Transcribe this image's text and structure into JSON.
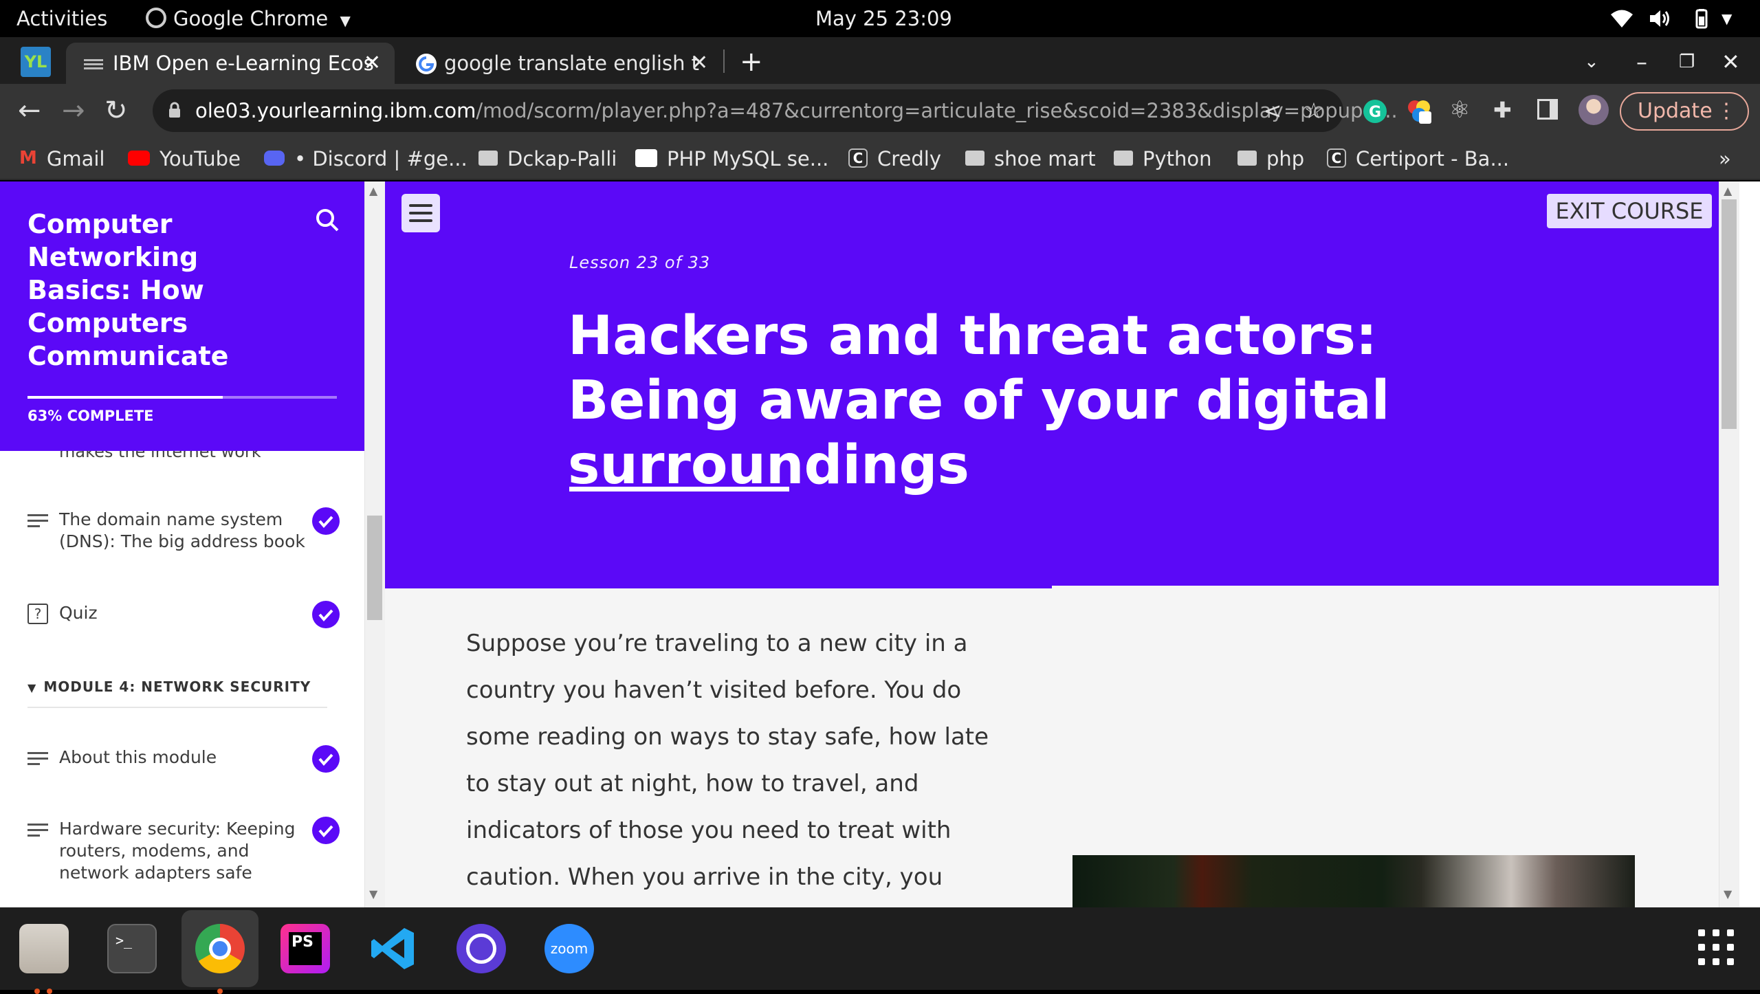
{
  "system": {
    "activities": "Activities",
    "app_name": "Google Chrome",
    "clock": "May 25  23:09"
  },
  "tabs": [
    {
      "title": "IBM Open e-Learning Ecos",
      "active": true
    },
    {
      "title": "google translate english t",
      "active": false
    }
  ],
  "toolbar": {
    "url_host": "ole03.yourlearning.ibm.com",
    "url_path": "/mod/scorm/player.php?a=487&currentorg=articulate_rise&scoid=2383&display=popup&...",
    "update_label": "Update"
  },
  "bookmarks": [
    {
      "label": "Gmail",
      "icon": "gmail-icon"
    },
    {
      "label": "YouTube",
      "icon": "youtube-icon"
    },
    {
      "label": "• Discord | #ge...",
      "icon": "discord-icon"
    },
    {
      "label": "Dckap-Palli",
      "icon": "folder-icon"
    },
    {
      "label": "PHP MySQL se...",
      "icon": "medium-icon"
    },
    {
      "label": "Credly",
      "icon": "credly-icon"
    },
    {
      "label": "shoe mart",
      "icon": "folder-icon"
    },
    {
      "label": "Python",
      "icon": "folder-icon"
    },
    {
      "label": "php",
      "icon": "folder-icon"
    },
    {
      "label": "Certiport - Ba...",
      "icon": "credly-icon"
    }
  ],
  "bookmarks_overflow": "»",
  "sidebar": {
    "course_title": "Computer Networking Basics: How Computers Communicate",
    "progress_percent": 63,
    "progress_label": "63% COMPLETE",
    "cut_off_text": "makes the internet work",
    "items": [
      {
        "label": "The domain name system (DNS): The big address book",
        "type": "lesson",
        "completed": true
      },
      {
        "label": "Quiz",
        "type": "quiz",
        "completed": true
      }
    ],
    "module_heading": "MODULE 4: NETWORK SECURITY",
    "module_items": [
      {
        "label": "About this module",
        "type": "lesson",
        "completed": true
      },
      {
        "label": "Hardware security: Keeping routers, modems, and network adapters safe",
        "type": "lesson",
        "completed": true
      }
    ]
  },
  "lesson": {
    "menu_icon": "hamburger-icon",
    "exit_label": "EXIT COURSE",
    "count_label": "Lesson 23 of 33",
    "title": "Hackers and threat actors: Being aware of your digital surroundings",
    "body": "Suppose you’re traveling to a new city in a country you haven’t visited before. You do some reading on ways to stay safe, how late to stay out at night, how to travel, and indicators of those you need to treat with caution. When you arrive in the city, you might be, at first, on high alert. You use"
  },
  "dock": [
    "files",
    "terminal",
    "chrome",
    "phpstorm",
    "vscode",
    "screen-recorder",
    "zoom"
  ],
  "dock_zoom_label": "zoom",
  "colors": {
    "accent": "#5b09f7",
    "exit_button_bg": "#e6dcff",
    "update_border": "#e8a89a"
  }
}
